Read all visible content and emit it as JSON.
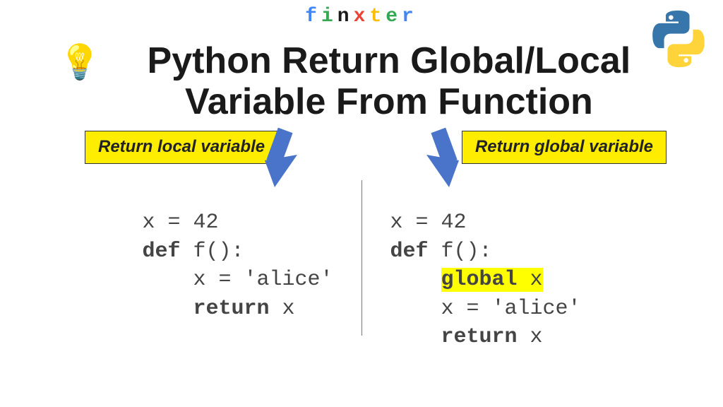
{
  "brand": {
    "letters": [
      "f",
      "i",
      "n",
      "x",
      "t",
      "e",
      "r"
    ]
  },
  "title": "Python Return Global/Local Variable From Function",
  "labels": {
    "left": "Return local variable",
    "right": "Return global variable"
  },
  "code": {
    "left": {
      "l1a": "x = ",
      "l1b": "42",
      "l2a": "def",
      "l2b": " f():",
      "l3": "x = 'alice'",
      "l4a": "return",
      "l4b": " x"
    },
    "right": {
      "l1a": "x = ",
      "l1b": "42",
      "l2a": "def",
      "l2b": " f():",
      "l3a": "global",
      "l3b": " x",
      "l4": "x = 'alice'",
      "l5a": "return",
      "l5b": " x"
    }
  },
  "colors": {
    "highlight": "#ffed00",
    "arrow": "#4a74c9"
  }
}
